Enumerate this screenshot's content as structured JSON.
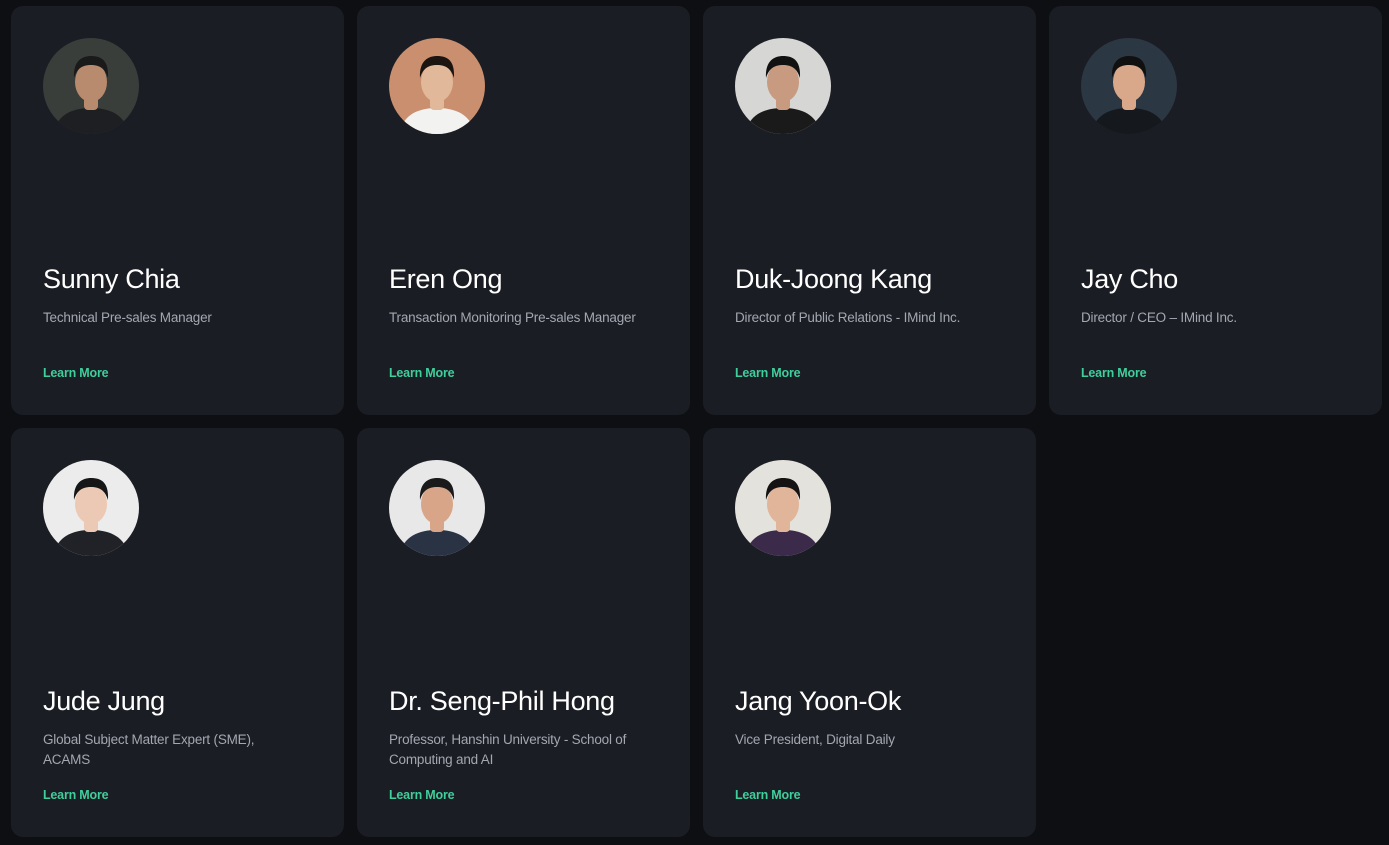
{
  "speakers": [
    {
      "name": "Sunny Chia",
      "role": "Technical Pre-sales Manager",
      "link": "Learn More",
      "photo_bg": "#3a3e3a",
      "skin": "#b88a6e",
      "hair": "#1a1a1a",
      "shirt": "#1e1f22"
    },
    {
      "name": "Eren Ong",
      "role": "Transaction Monitoring Pre-sales Manager",
      "link": "Learn More",
      "photo_bg": "#c98f6e",
      "skin": "#e2b89a",
      "hair": "#1c1410",
      "shirt": "#f2f2f0"
    },
    {
      "name": "Duk-Joong Kang",
      "role": "Director of Public Relations - IMind Inc.",
      "link": "Learn More",
      "photo_bg": "#d6d6d4",
      "skin": "#c89a80",
      "hair": "#111111",
      "shirt": "#1a1a1a"
    },
    {
      "name": "Jay Cho",
      "role": "Director / CEO – IMind Inc.",
      "link": "Learn More",
      "photo_bg": "#2c3744",
      "skin": "#d9a88a",
      "hair": "#101010",
      "shirt": "#15181d"
    },
    {
      "name": "Jude Jung",
      "role": "Global Subject Matter Expert (SME), ACAMS",
      "link": "Learn More",
      "photo_bg": "#ececec",
      "skin": "#ecc9b4",
      "hair": "#161616",
      "shirt": "#202228"
    },
    {
      "name": "Dr. Seng-Phil Hong",
      "role": "Professor, Hanshin University - School of Computing and AI",
      "link": "Learn More",
      "photo_bg": "#e8e8e8",
      "skin": "#d9a588",
      "hair": "#1a1a1a",
      "shirt": "#2a3344"
    },
    {
      "name": "Jang Yoon-Ok",
      "role": "Vice President, Digital Daily",
      "link": "Learn More",
      "photo_bg": "#e4e2dc",
      "skin": "#e0b59a",
      "hair": "#141212",
      "shirt": "#3b2a4a"
    }
  ]
}
